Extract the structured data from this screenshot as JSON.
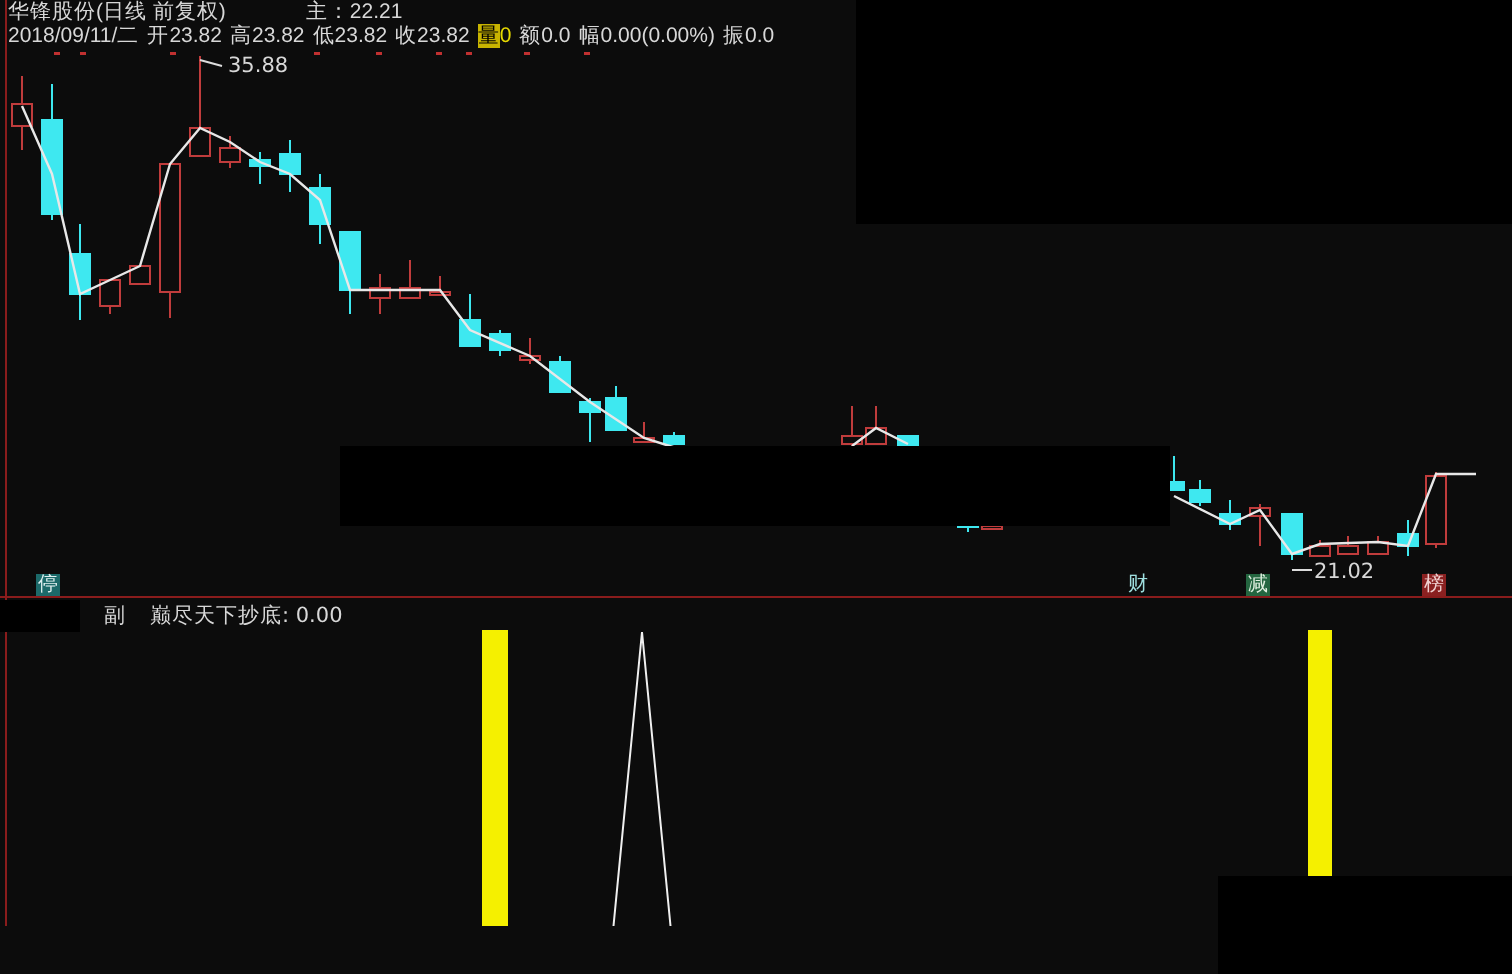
{
  "header": {
    "title": "华锋股份(日线 前复权)",
    "main_indicator": "主：22.21"
  },
  "quote": {
    "date": "2018/09/11/二",
    "open": "开23.82",
    "high": "高23.82",
    "low": "低23.82",
    "close": "收23.82",
    "volume_label": "量",
    "volume": "0",
    "amount": "额0.0",
    "change": "幅0.00(0.00%)",
    "amplitude": "振0.0"
  },
  "chart_labels": {
    "high_price": "35.88",
    "low_price": "21.02"
  },
  "event_badges": [
    {
      "text": "停",
      "kind": "teal"
    },
    {
      "text": "财",
      "kind": "plain"
    },
    {
      "text": "减",
      "kind": "green"
    },
    {
      "text": "榜",
      "kind": "red"
    }
  ],
  "sub_chart": {
    "label": "副",
    "indicator": "巅尽天下抄底: 0.00"
  }
}
